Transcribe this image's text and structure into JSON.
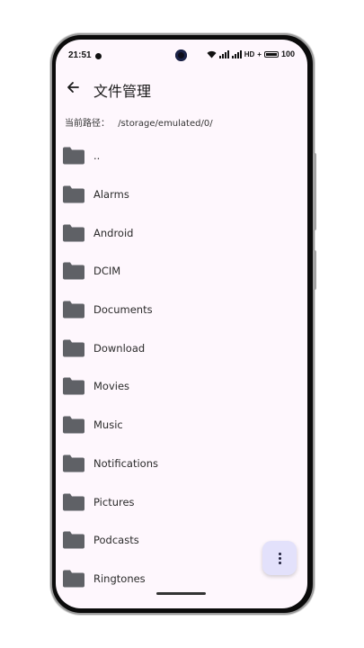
{
  "status_bar": {
    "time": "21:51",
    "network_label": "HD",
    "battery_level": "100"
  },
  "app_bar": {
    "title": "文件管理",
    "back_icon": "arrow-left-icon"
  },
  "path": {
    "label": "当前路径：",
    "value": "/storage/emulated/0/"
  },
  "files": [
    {
      "name": "..",
      "icon": "folder-icon"
    },
    {
      "name": "Alarms",
      "icon": "folder-icon"
    },
    {
      "name": "Android",
      "icon": "folder-icon"
    },
    {
      "name": "DCIM",
      "icon": "folder-icon"
    },
    {
      "name": "Documents",
      "icon": "folder-icon"
    },
    {
      "name": "Download",
      "icon": "folder-icon"
    },
    {
      "name": "Movies",
      "icon": "folder-icon"
    },
    {
      "name": "Music",
      "icon": "folder-icon"
    },
    {
      "name": "Notifications",
      "icon": "folder-icon"
    },
    {
      "name": "Pictures",
      "icon": "folder-icon"
    },
    {
      "name": "Podcasts",
      "icon": "folder-icon"
    },
    {
      "name": "Ringtones",
      "icon": "folder-icon"
    }
  ],
  "fab": {
    "icon": "more-vertical-icon"
  },
  "colors": {
    "screen_background": "#fef7fd",
    "folder": "#5f6166",
    "fab_background": "#e3e1fb"
  }
}
